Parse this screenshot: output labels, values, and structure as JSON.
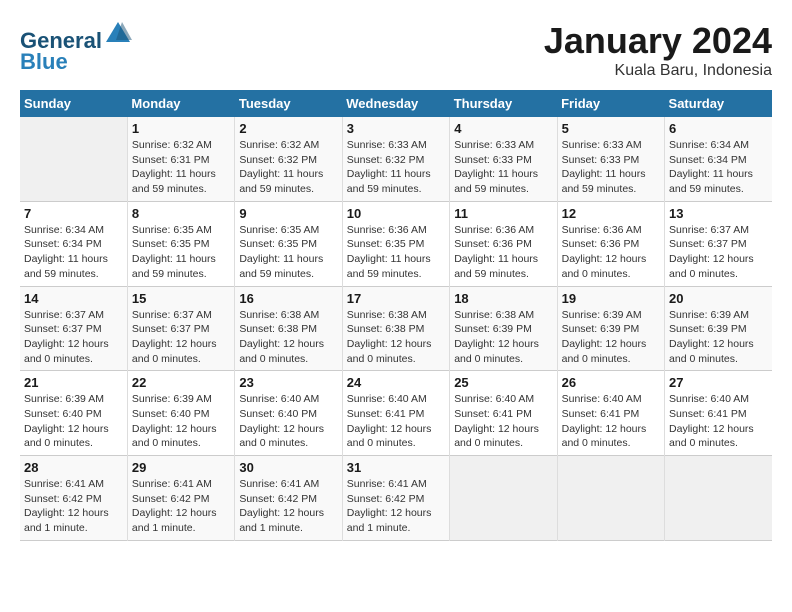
{
  "logo": {
    "line1": "General",
    "line2": "Blue"
  },
  "title": "January 2024",
  "subtitle": "Kuala Baru, Indonesia",
  "header": {
    "accent_color": "#2471a3"
  },
  "days_of_week": [
    "Sunday",
    "Monday",
    "Tuesday",
    "Wednesday",
    "Thursday",
    "Friday",
    "Saturday"
  ],
  "weeks": [
    [
      {
        "day": "",
        "info": ""
      },
      {
        "day": "1",
        "info": "Sunrise: 6:32 AM\nSunset: 6:31 PM\nDaylight: 11 hours\nand 59 minutes."
      },
      {
        "day": "2",
        "info": "Sunrise: 6:32 AM\nSunset: 6:32 PM\nDaylight: 11 hours\nand 59 minutes."
      },
      {
        "day": "3",
        "info": "Sunrise: 6:33 AM\nSunset: 6:32 PM\nDaylight: 11 hours\nand 59 minutes."
      },
      {
        "day": "4",
        "info": "Sunrise: 6:33 AM\nSunset: 6:33 PM\nDaylight: 11 hours\nand 59 minutes."
      },
      {
        "day": "5",
        "info": "Sunrise: 6:33 AM\nSunset: 6:33 PM\nDaylight: 11 hours\nand 59 minutes."
      },
      {
        "day": "6",
        "info": "Sunrise: 6:34 AM\nSunset: 6:34 PM\nDaylight: 11 hours\nand 59 minutes."
      }
    ],
    [
      {
        "day": "7",
        "info": "Sunrise: 6:34 AM\nSunset: 6:34 PM\nDaylight: 11 hours\nand 59 minutes."
      },
      {
        "day": "8",
        "info": "Sunrise: 6:35 AM\nSunset: 6:35 PM\nDaylight: 11 hours\nand 59 minutes."
      },
      {
        "day": "9",
        "info": "Sunrise: 6:35 AM\nSunset: 6:35 PM\nDaylight: 11 hours\nand 59 minutes."
      },
      {
        "day": "10",
        "info": "Sunrise: 6:36 AM\nSunset: 6:35 PM\nDaylight: 11 hours\nand 59 minutes."
      },
      {
        "day": "11",
        "info": "Sunrise: 6:36 AM\nSunset: 6:36 PM\nDaylight: 11 hours\nand 59 minutes."
      },
      {
        "day": "12",
        "info": "Sunrise: 6:36 AM\nSunset: 6:36 PM\nDaylight: 12 hours\nand 0 minutes."
      },
      {
        "day": "13",
        "info": "Sunrise: 6:37 AM\nSunset: 6:37 PM\nDaylight: 12 hours\nand 0 minutes."
      }
    ],
    [
      {
        "day": "14",
        "info": "Sunrise: 6:37 AM\nSunset: 6:37 PM\nDaylight: 12 hours\nand 0 minutes."
      },
      {
        "day": "15",
        "info": "Sunrise: 6:37 AM\nSunset: 6:37 PM\nDaylight: 12 hours\nand 0 minutes."
      },
      {
        "day": "16",
        "info": "Sunrise: 6:38 AM\nSunset: 6:38 PM\nDaylight: 12 hours\nand 0 minutes."
      },
      {
        "day": "17",
        "info": "Sunrise: 6:38 AM\nSunset: 6:38 PM\nDaylight: 12 hours\nand 0 minutes."
      },
      {
        "day": "18",
        "info": "Sunrise: 6:38 AM\nSunset: 6:39 PM\nDaylight: 12 hours\nand 0 minutes."
      },
      {
        "day": "19",
        "info": "Sunrise: 6:39 AM\nSunset: 6:39 PM\nDaylight: 12 hours\nand 0 minutes."
      },
      {
        "day": "20",
        "info": "Sunrise: 6:39 AM\nSunset: 6:39 PM\nDaylight: 12 hours\nand 0 minutes."
      }
    ],
    [
      {
        "day": "21",
        "info": "Sunrise: 6:39 AM\nSunset: 6:40 PM\nDaylight: 12 hours\nand 0 minutes."
      },
      {
        "day": "22",
        "info": "Sunrise: 6:39 AM\nSunset: 6:40 PM\nDaylight: 12 hours\nand 0 minutes."
      },
      {
        "day": "23",
        "info": "Sunrise: 6:40 AM\nSunset: 6:40 PM\nDaylight: 12 hours\nand 0 minutes."
      },
      {
        "day": "24",
        "info": "Sunrise: 6:40 AM\nSunset: 6:41 PM\nDaylight: 12 hours\nand 0 minutes."
      },
      {
        "day": "25",
        "info": "Sunrise: 6:40 AM\nSunset: 6:41 PM\nDaylight: 12 hours\nand 0 minutes."
      },
      {
        "day": "26",
        "info": "Sunrise: 6:40 AM\nSunset: 6:41 PM\nDaylight: 12 hours\nand 0 minutes."
      },
      {
        "day": "27",
        "info": "Sunrise: 6:40 AM\nSunset: 6:41 PM\nDaylight: 12 hours\nand 0 minutes."
      }
    ],
    [
      {
        "day": "28",
        "info": "Sunrise: 6:41 AM\nSunset: 6:42 PM\nDaylight: 12 hours\nand 1 minute."
      },
      {
        "day": "29",
        "info": "Sunrise: 6:41 AM\nSunset: 6:42 PM\nDaylight: 12 hours\nand 1 minute."
      },
      {
        "day": "30",
        "info": "Sunrise: 6:41 AM\nSunset: 6:42 PM\nDaylight: 12 hours\nand 1 minute."
      },
      {
        "day": "31",
        "info": "Sunrise: 6:41 AM\nSunset: 6:42 PM\nDaylight: 12 hours\nand 1 minute."
      },
      {
        "day": "",
        "info": ""
      },
      {
        "day": "",
        "info": ""
      },
      {
        "day": "",
        "info": ""
      }
    ]
  ]
}
